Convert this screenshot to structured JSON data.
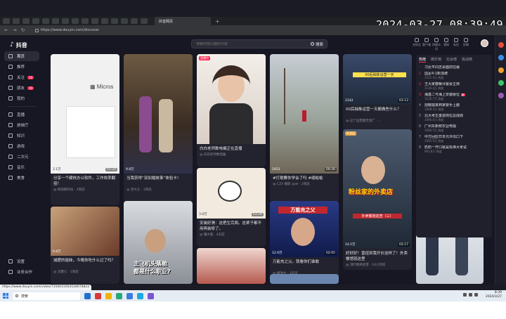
{
  "overlay": {
    "timestamp": "2024-03-27 08:39:49"
  },
  "browser": {
    "active_tab_title": "抖音网页",
    "url": "https://www.douyin.com/discover",
    "status_link": "https://www.douyin.com/video/7350615054528078822"
  },
  "sidebar": {
    "logo": "抖音",
    "items": [
      {
        "label": "首页",
        "icon": "home-icon",
        "active": true
      },
      {
        "label": "推荐",
        "icon": "recommend-icon"
      },
      {
        "label": "关注",
        "icon": "follow-icon",
        "badge": "19"
      },
      {
        "label": "朋友",
        "icon": "friends-icon",
        "badge": "19"
      },
      {
        "label": "我的",
        "icon": "profile-icon"
      },
      {
        "label": "直播",
        "icon": "live-icon"
      },
      {
        "label": "放映厅",
        "icon": "cinema-icon"
      },
      {
        "label": "知识",
        "icon": "knowledge-icon"
      },
      {
        "label": "游戏",
        "icon": "game-icon"
      },
      {
        "label": "二次元",
        "icon": "anime-icon"
      },
      {
        "label": "音乐",
        "icon": "music-icon"
      },
      {
        "label": "美食",
        "icon": "food-icon"
      }
    ],
    "bottom": [
      {
        "label": "设置",
        "icon": "settings-icon"
      },
      {
        "label": "业务合作",
        "icon": "business-icon"
      }
    ]
  },
  "search": {
    "placeholder": "搜索你感兴趣的内容",
    "button_label": "搜索"
  },
  "top_icons": [
    {
      "label": "充钻石",
      "icon": "diamond-icon"
    },
    {
      "label": "客户端",
      "icon": "client-icon"
    },
    {
      "label": "快捷访问",
      "icon": "shortcut-icon"
    },
    {
      "label": "通知",
      "icon": "bell-icon"
    },
    {
      "label": "私信",
      "icon": "message-icon"
    },
    {
      "label": "投稿",
      "icon": "upload-icon"
    }
  ],
  "feed": {
    "cards": [
      {
        "title": "分享一个硬核办公软件，工作效率翻倍！",
        "author": "@ 佩琪聊科技 · 3周前",
        "duration": "01:20",
        "likes": "2.1万"
      },
      {
        "title": "当我获得“双如婚故事”体验卡！",
        "author": "@ 李大头 · 1周前",
        "duration": "00:35",
        "likes": "9.8万"
      },
      {
        "title": "白白老师数电编正在直播",
        "author": "@ 白白老师数电编",
        "duration": "",
        "likes": "",
        "live_tag": "直播中"
      },
      {
        "title": "#打歌舞你学会了吗 #缝蛤蛤",
        "author": "@ CZX 播影 @wl · 2周前",
        "duration": "00:26",
        "likes": "2453"
      },
      {
        "title": "00后抽象运营一天都做些什么？",
        "author": "@ 这个运营都无哈厂 · ...",
        "duration": "01:13",
        "likes": "2142"
      },
      {
        "title": "减肥的姐妹，今晚你吃什么过了吗？",
        "author": "@ 灵震七 · 1周前",
        "duration": "",
        "likes": "6.8万"
      },
      {
        "title": "安装好滑：这把生完周。这辈子都不用再装修了。",
        "author": "@ 懂大狐 · 4天前",
        "duration": "03:28",
        "likes": "3.6万"
      },
      {
        "title": "万能充之父。我看你们谁敢",
        "author": "@ 播放台 · 3天前",
        "duration": "02:05",
        "likes": "12.9万"
      },
      {
        "title": "好好好！曾扭到我开价这样了！外卖餐馆就这里",
        "author": "@ 顶叶联络星客 · 14小时前",
        "duration": "02:17",
        "likes": "14.5万",
        "label_tag": "外卖监"
      },
      {
        "title": "",
        "author": "",
        "duration": "",
        "likes": ""
      },
      {
        "title": "",
        "author": "",
        "duration": "",
        "likes": ""
      },
      {
        "title": "",
        "author": "",
        "duration": "",
        "likes": ""
      },
      {
        "title": "",
        "author": "",
        "duration": "",
        "likes": ""
      }
    ]
  },
  "hotlist": {
    "tabs": [
      "热榜",
      "娱乐榜",
      "社会榜",
      "挑战榜"
    ],
    "items": [
      {
        "rank": "·",
        "title": "习近平同志会面前往最",
        "heat": "",
        "badge": ""
      },
      {
        "rank": "1",
        "title": "国足4:1新加坡",
        "heat": "1151.4万 热度",
        "badge": ""
      },
      {
        "rank": "2",
        "title": "王大家春暖评委会主持",
        "heat": "1136.4万 热度",
        "badge": ""
      },
      {
        "rank": "3",
        "title": "海基二号海上安装就位",
        "heat": "1126.7万 热度",
        "badge": "新"
      },
      {
        "rank": "4",
        "title": "把鞍揣来到家要手上都",
        "heat": "1098.2万 热度",
        "badge": ""
      },
      {
        "rank": "5",
        "title": "北大考生重返岗位总成绩",
        "heat": "1096.6万 热度",
        "badge": ""
      },
      {
        "rank": "6",
        "title": "广州东新鲜农业电视",
        "heat": "1066.5万 热度",
        "badge": ""
      },
      {
        "rank": "7",
        "title": "中方回应日本允许出口下",
        "heat": "1065.0万 热度",
        "badge": ""
      },
      {
        "rank": "8",
        "title": "奶奶一开口就是标准大考试",
        "heat": "963.8万 热度",
        "badge": ""
      }
    ]
  },
  "taskbar": {
    "search_label": "搜索",
    "time": "8:39",
    "date": "2024/3/27"
  }
}
